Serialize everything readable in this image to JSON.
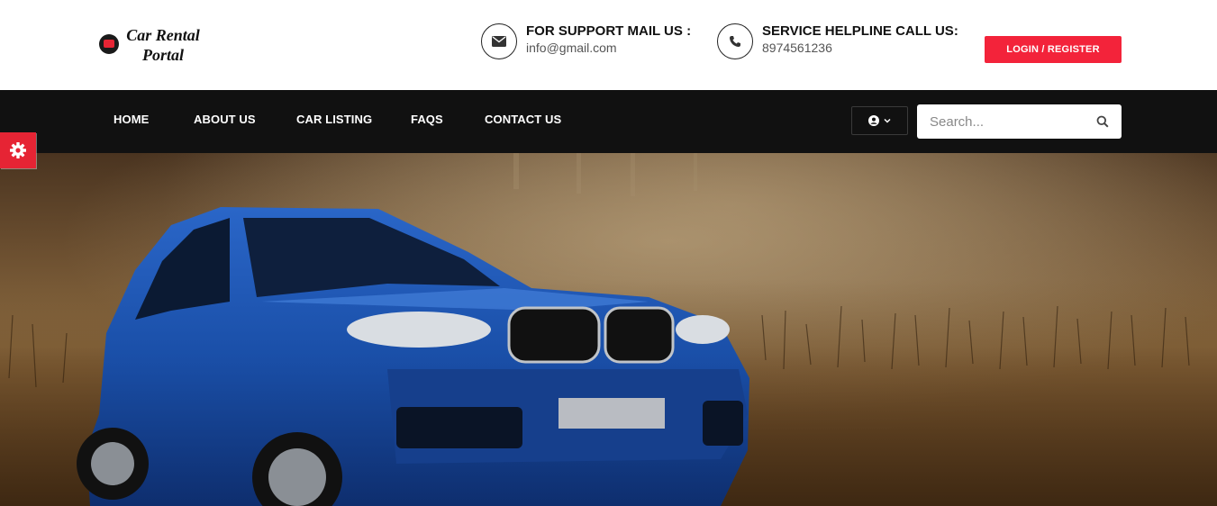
{
  "brand": {
    "name_line1": "Car Rental",
    "name_line2": "Portal"
  },
  "contact": {
    "mail_title": "FOR SUPPORT MAIL US :",
    "mail_value": "info@gmail.com",
    "phone_title": "SERVICE HELPLINE CALL US:",
    "phone_value": "8974561236"
  },
  "header": {
    "login_label": "LOGIN / REGISTER"
  },
  "nav": {
    "items": [
      {
        "label": "HOME"
      },
      {
        "label": "ABOUT US"
      },
      {
        "label": "CAR LISTING"
      },
      {
        "label": "FAQS"
      },
      {
        "label": "CONTACT US"
      }
    ]
  },
  "search": {
    "placeholder": "Search..."
  },
  "colors": {
    "accent": "#f3233a",
    "nav_bg": "#111111",
    "car_blue": "#1a4fa8"
  },
  "icons": [
    "envelope-icon",
    "phone-icon",
    "user-circle-icon",
    "chevron-down-icon",
    "search-icon",
    "gear-icon"
  ]
}
